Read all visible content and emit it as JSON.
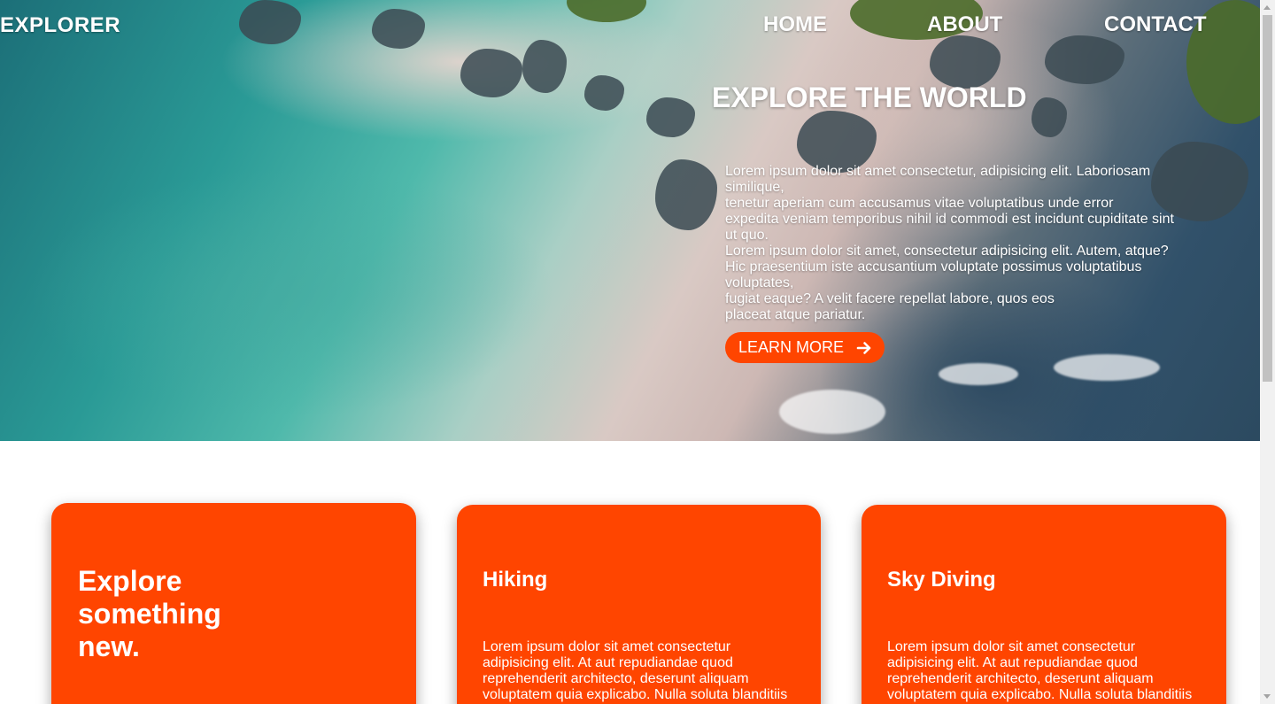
{
  "header": {
    "brand": "EXPLORER",
    "nav": [
      "HOME",
      "ABOUT",
      "CONTACT"
    ]
  },
  "hero": {
    "title": "EXPLORE THE WORLD",
    "text_lines": [
      "Lorem ipsum dolor sit amet consectetur, adipisicing elit. Laboriosam similique,",
      "tenetur aperiam cum accusamus vitae voluptatibus unde error",
      "expedita veniam temporibus nihil id commodi est incidunt cupiditate sint ut quo.",
      "Lorem ipsum dolor sit amet, consectetur adipisicing elit. Autem, atque?",
      "Hic praesentium iste accusantium voluptate possimus voluptatibus voluptates,",
      "fugiat eaque? A velit facere repellat labore, quos eos",
      "placeat atque pariatur."
    ],
    "button_label": "LEARN MORE",
    "button_icon": "arrow-right-icon"
  },
  "cards": [
    {
      "title": "Explore something new.",
      "text": ""
    },
    {
      "title": "Hiking",
      "text": "Lorem ipsum dolor sit amet consectetur adipisicing elit. At aut repudiandae quod reprehenderit architecto, deserunt aliquam voluptatem quia explicabo. Nulla soluta blanditiis"
    },
    {
      "title": "Sky Diving",
      "text": "Lorem ipsum dolor sit amet consectetur adipisicing elit. At aut repudiandae quod reprehenderit architecto, deserunt aliquam voluptatem quia explicabo. Nulla soluta blanditiis"
    }
  ],
  "colors": {
    "accent": "#ff4500",
    "text_on_dark": "#ffffff",
    "page_bg": "#ffffff"
  }
}
